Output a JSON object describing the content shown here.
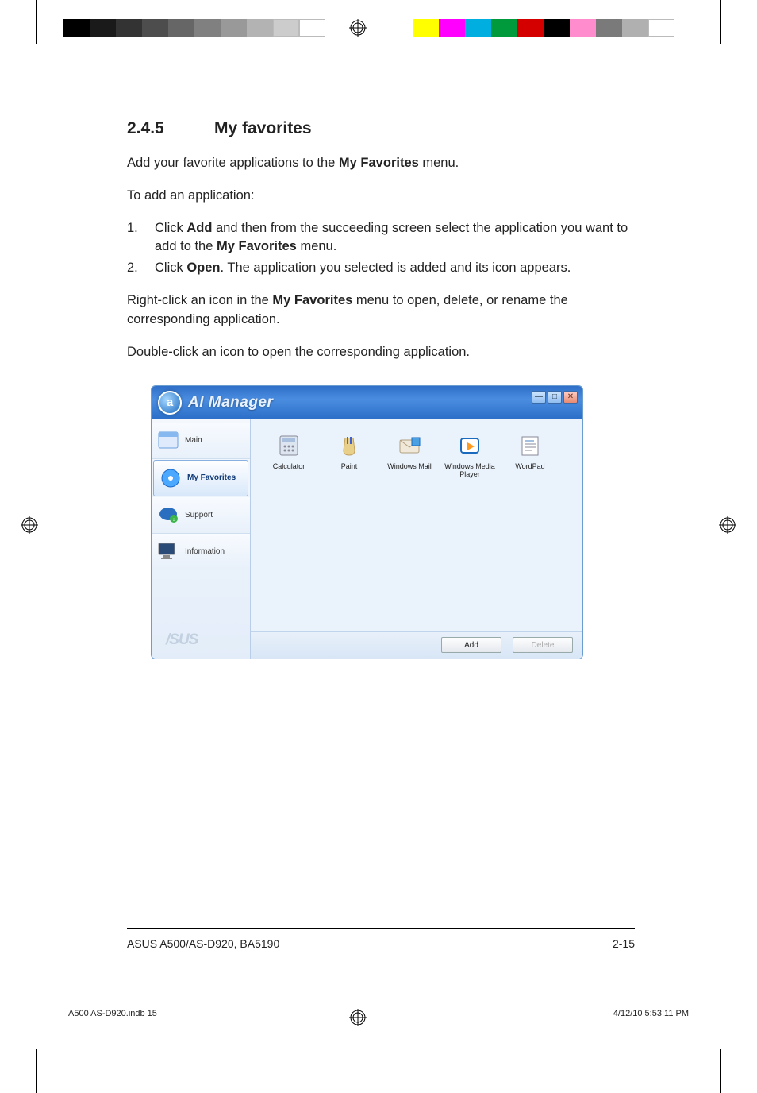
{
  "doc": {
    "section_number": "2.4.5",
    "section_title": "My favorites",
    "intro_pre": "Add your favorite applications to the ",
    "intro_bold": "My Favorites",
    "intro_post": " menu.",
    "to_add": "To add an application:",
    "step1_a": "Click ",
    "step1_b": "Add",
    "step1_c": " and then from the succeeding screen select the application you want to add to the ",
    "step1_d": "My Favorites",
    "step1_e": " menu.",
    "step2_a": "Click ",
    "step2_b": "Open",
    "step2_c": ". The application you selected is added and its icon appears.",
    "rightclick_a": "Right-click an icon in the ",
    "rightclick_b": "My Favorites",
    "rightclick_c": " menu to open, delete, or rename the corresponding application.",
    "doubleclick": "Double-click an icon to open the corresponding application.",
    "footer_model": "ASUS A500/AS-D920, BA5190",
    "page_number": "2-15",
    "indb_file": "A500 AS-D920.indb   15",
    "indb_stamp": "4/12/10   5:53:11 PM"
  },
  "app": {
    "title": "AI Manager",
    "logo_letter": "a",
    "sidebar": {
      "items": [
        {
          "label": "Main",
          "icon": "window-icon"
        },
        {
          "label": "My Favorites",
          "icon": "disc-icon",
          "active": true
        },
        {
          "label": "Support",
          "icon": "asus-support-icon"
        },
        {
          "label": "Information",
          "icon": "monitor-icon"
        }
      ],
      "brand": "/SUS"
    },
    "favorites": [
      {
        "label": "Calculator",
        "icon": "calculator-icon"
      },
      {
        "label": "Paint",
        "icon": "paint-icon"
      },
      {
        "label": "Windows Mail",
        "icon": "mail-icon"
      },
      {
        "label": "Windows Media Player",
        "icon": "media-player-icon"
      },
      {
        "label": "WordPad",
        "icon": "wordpad-icon"
      }
    ],
    "buttons": {
      "add": "Add",
      "delete": "Delete"
    }
  }
}
